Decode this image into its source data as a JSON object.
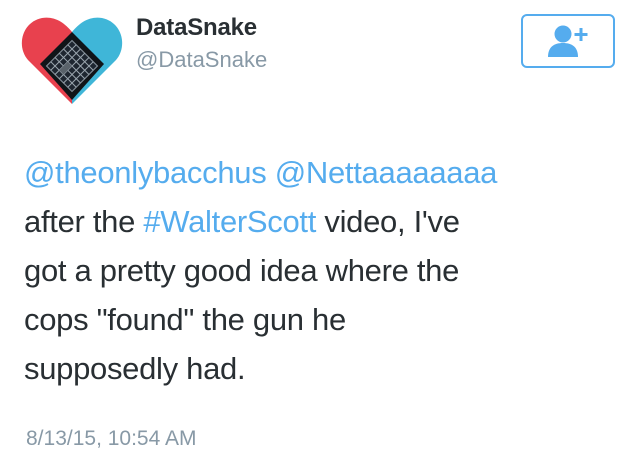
{
  "author": {
    "display_name": "DataSnake",
    "handle": "@DataSnake"
  },
  "follow_button": {
    "icon": "add-user-icon"
  },
  "tweet": {
    "mention_1": "@theonlybacchus",
    "mention_2": "@Nettaaaaaaaa",
    "text_before_hashtag": "after the ",
    "hashtag": "#WalterScott",
    "text_after_hashtag": " video, I've",
    "line_3": "got a pretty good idea where the",
    "line_4": "cops \"found\" the gun he",
    "line_5": "supposedly had."
  },
  "timestamp": "8/13/15, 10:54 AM",
  "colors": {
    "link": "#55acee",
    "text": "#292f33",
    "muted": "#8899a6",
    "avatar_left": "#e8414e",
    "avatar_right": "#3fb6d8"
  }
}
